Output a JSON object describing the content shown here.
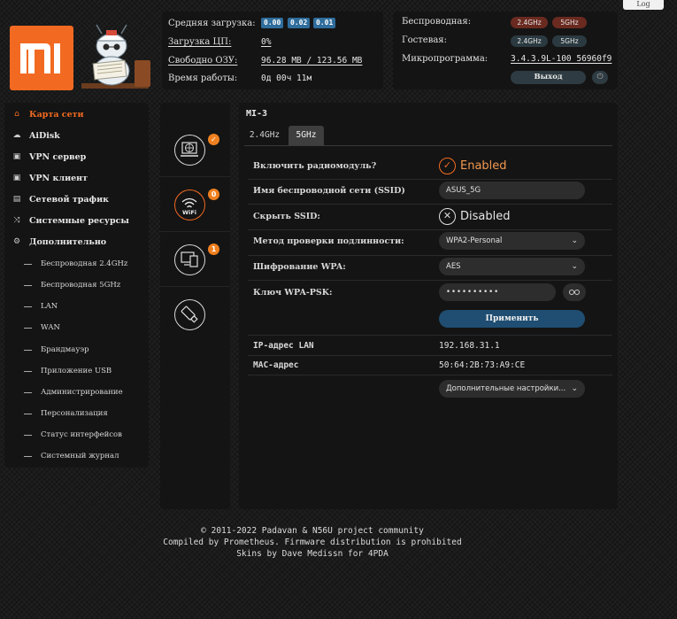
{
  "status": {
    "cpu_load_label": "Средняя загрузка:",
    "load_1": "0.00",
    "load_5": "0.02",
    "load_15": "0.01",
    "cpu_label": "Загрузка ЦП:",
    "cpu_value": "0%",
    "ram_label": "Свободно ОЗУ:",
    "ram_value": "96.28 MB / 123.56 MB",
    "uptime_label": "Время работы:",
    "uptime_value": "0д 00ч 11м"
  },
  "wireless": {
    "wireless_label": "Беспроводная:",
    "guest_label": "Гостевая:",
    "firmware_label": "Микропрограмма:",
    "band_24": "2.4GHz",
    "band_5": "5GHz",
    "firmware_value": "3.4.3.9L-100_56960f9",
    "logout_label": "Выход",
    "power_icon": "⏻"
  },
  "log_tab": "Log",
  "sidebar": {
    "items": [
      {
        "label": "Карта сети",
        "icon": "⌂"
      },
      {
        "label": "AiDisk",
        "icon": "☁"
      },
      {
        "label": "VPN сервер",
        "icon": "▣"
      },
      {
        "label": "VPN клиент",
        "icon": "▣"
      },
      {
        "label": "Сетевой трафик",
        "icon": "▤"
      },
      {
        "label": "Системные ресурсы",
        "icon": "⤨"
      },
      {
        "label": "Дополнительно",
        "icon": "⚙"
      }
    ],
    "subitems": [
      "Беспроводная 2.4GHz",
      "Беспроводная 5GHz",
      "LAN",
      "WAN",
      "Брандмауэр",
      "Приложение USB",
      "Администрирование",
      "Персонализация",
      "Статус интерфейсов",
      "Системный журнал"
    ]
  },
  "icon_column": {
    "badge_check": "✓",
    "badge_wifi": "0",
    "badge_clients": "1",
    "wifi_text": "WiFi"
  },
  "main": {
    "title": "MI-3",
    "tab_24": "2.4GHz",
    "tab_5": "5GHz",
    "radio_label": "Включить радиомодуль?",
    "radio_value": "Enabled",
    "ssid_label": "Имя беспроводной сети (SSID)",
    "ssid_value": "ASUS_5G",
    "hide_ssid_label": "Скрыть SSID:",
    "hide_ssid_value": "Disabled",
    "auth_label": "Метод проверки подлинности:",
    "auth_value": "WPA2-Personal",
    "enc_label": "Шифрование WPA:",
    "enc_value": "AES",
    "psk_label": "Ключ WPA-PSK:",
    "psk_value": "••••••••••",
    "apply_label": "Применить",
    "lan_ip_label": "IP-адрес LAN",
    "lan_ip_value": "192.168.31.1",
    "mac_label": "MAC-адрес",
    "mac_value": "50:64:2B:73:A9:CE",
    "advanced_value": "Дополнительные настройки..."
  },
  "footer": {
    "line1": "© 2011-2022 Padavan & N56U project community",
    "line2": "Compiled by Prometheus. Firmware distribution is prohibited",
    "line3": "Skins by Dave Medissn for 4PDA"
  }
}
